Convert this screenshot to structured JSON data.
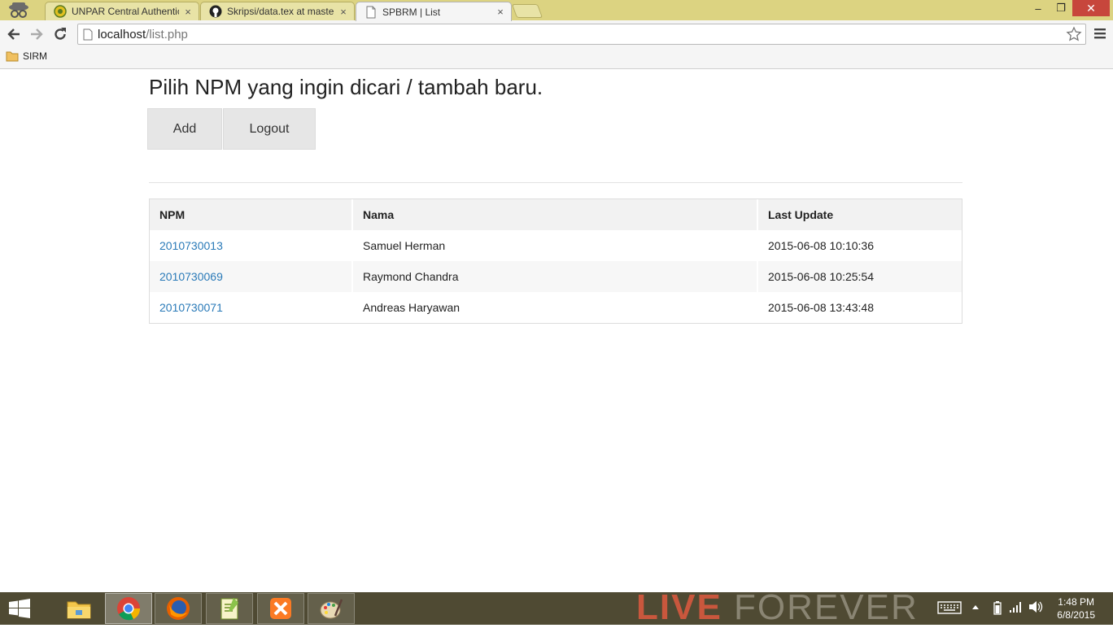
{
  "browser": {
    "tabs": [
      {
        "title": "UNPAR Central Authenticati",
        "icon": "unpar-favicon"
      },
      {
        "title": "Skripsi/data.tex at master",
        "icon": "github-icon"
      },
      {
        "title": "SPBRM | List",
        "icon": "page-icon"
      }
    ],
    "tab_close_glyph": "×",
    "address": {
      "host": "localhost",
      "path": "/list.php"
    },
    "bookmarks": [
      {
        "label": "SIRM",
        "icon": "folder-icon"
      }
    ],
    "window_controls": {
      "minimize": "–",
      "restore": "❐",
      "close": "✕"
    }
  },
  "page": {
    "heading": "Pilih NPM yang ingin dicari / tambah baru.",
    "buttons": {
      "add": "Add",
      "logout": "Logout"
    },
    "table": {
      "headers": [
        "NPM",
        "Nama",
        "Last Update"
      ],
      "rows": [
        {
          "npm": "2010730013",
          "nama": "Samuel Herman",
          "last_update": "2015-06-08 10:10:36"
        },
        {
          "npm": "2010730069",
          "nama": "Raymond Chandra",
          "last_update": "2015-06-08 10:25:54"
        },
        {
          "npm": "2010730071",
          "nama": "Andreas Haryawan",
          "last_update": "2015-06-08 13:43:48"
        }
      ]
    },
    "link_color": "#2a7ab8"
  },
  "taskbar": {
    "apps": [
      "file-explorer-icon",
      "chrome-icon",
      "firefox-icon",
      "notepad-plus-plus-icon",
      "xampp-icon",
      "paint-icon"
    ],
    "wallpaper_text": {
      "part1": "LIVE",
      "part2": "FOREVER"
    },
    "clock": {
      "time": "1:48 PM",
      "date": "6/8/2015"
    }
  }
}
